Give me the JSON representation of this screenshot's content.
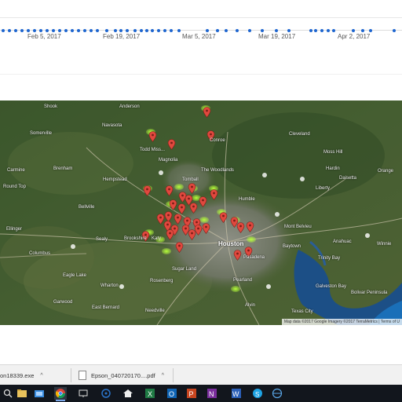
{
  "timeline": {
    "labels": [
      "Feb 5, 2017",
      "Feb 19, 2017",
      "Mar 5, 2017",
      "Mar 19, 2017",
      "Apr 2, 2017"
    ]
  },
  "map": {
    "attribution": "Map data ©2017 Google Imagery ©2017 TerraMetrics | Terms of U",
    "cities": {
      "shook": "Shook",
      "anderson": "Anderson",
      "navasota": "Navasota",
      "somerville": "Somerville",
      "todd_mission": "Todd Miss...",
      "magnolia": "Magnolia",
      "conroe": "Conroe",
      "cleveland": "Cleveland",
      "woodlands": "The Woodlands",
      "tomball": "Tomball",
      "hempstead": "Hempstead",
      "brenham": "Brenham",
      "carmine": "Carmine",
      "round_top": "Round Top",
      "bellville": "Bellville",
      "humble": "Humble",
      "liberty": "Liberty",
      "daisetta": "Daisetta",
      "moss_hill": "Moss Hill",
      "hardin": "Hardin",
      "mont_belvieu": "Mont Belvieu",
      "baytown": "Baytown",
      "anahuac": "Anahuac",
      "houston": "Houston",
      "katy": "Katy",
      "brookshire": "Brookshire",
      "sealy": "Sealy",
      "ellinger": "Ellinger",
      "columbus": "Columbus",
      "eagle_lake": "Eagle Lake",
      "garwood": "Garwood",
      "east_bernard": "East Bernard",
      "rosenberg": "Rosenberg",
      "sugar_land": "Sugar Land",
      "pasadena": "Pasadena",
      "pearland": "Pearland",
      "alvin": "Alvin",
      "texas_city": "Texas City",
      "bolivar": "Bolivar Peninsula",
      "galveston_bay": "Galveston Bay",
      "trinity_bay": "Trinity Bay",
      "needville": "Needville",
      "wharton": "Wharton",
      "winnie": "Winnie",
      "orange": "Orange"
    }
  },
  "downloads": {
    "item1": "on18339.exe",
    "item2": "Epson_040720170....pdf",
    "chevron": "^"
  },
  "taskbar": {
    "icons": [
      "search-icon",
      "task-view-icon",
      "file-explorer-icon",
      "folder-icon",
      "chrome-icon",
      "network-icon",
      "media-icon",
      "home-icon",
      "excel-icon",
      "outlook-icon",
      "powerpoint-icon",
      "onenote-icon",
      "word-icon",
      "skype-icon",
      "globe-icon"
    ]
  },
  "colors": {
    "accent_blue": "#1e66d0",
    "marker_red": "#e0483e",
    "heat_green": "#9cf52a",
    "water": "#1b4f8a"
  }
}
